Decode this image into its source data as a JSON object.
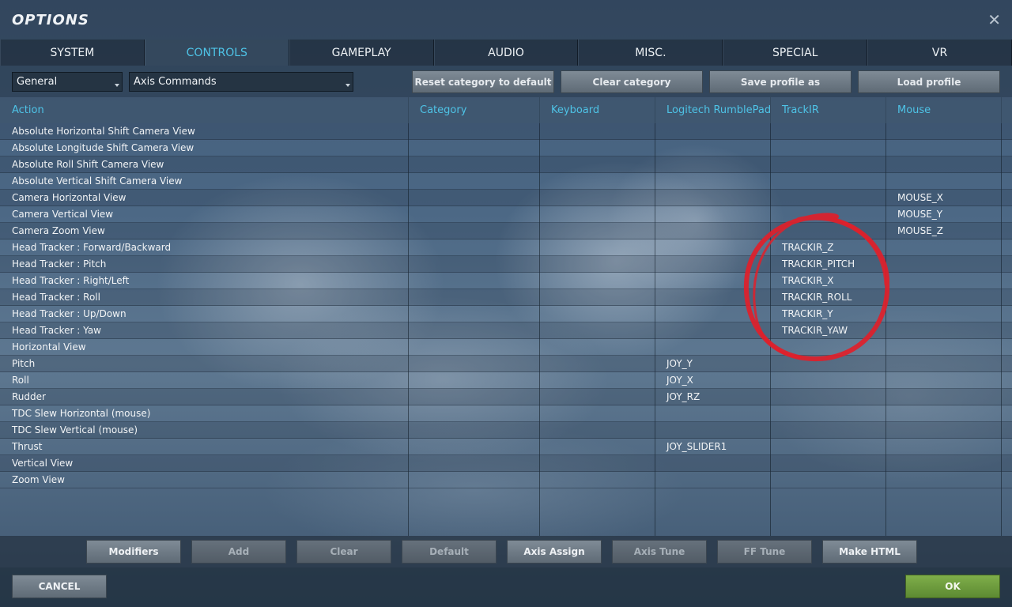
{
  "window": {
    "title": "OPTIONS",
    "close_icon": "close-icon",
    "close_glyph": "✕"
  },
  "tabs": [
    {
      "label": "SYSTEM",
      "active": false
    },
    {
      "label": "CONTROLS",
      "active": true
    },
    {
      "label": "GAMEPLAY",
      "active": false
    },
    {
      "label": "AUDIO",
      "active": false
    },
    {
      "label": "MISC.",
      "active": false
    },
    {
      "label": "SPECIAL",
      "active": false
    },
    {
      "label": "VR",
      "active": false
    }
  ],
  "toolbar": {
    "aircraft_select": "General",
    "category_select": "Axis Commands",
    "reset_label": "Reset category to default",
    "clear_category_label": "Clear category",
    "save_profile_label": "Save profile as",
    "load_profile_label": "Load profile"
  },
  "table": {
    "headers": {
      "action": "Action",
      "category": "Category",
      "keyboard": "Keyboard",
      "joystick": "Logitech RumblePad...",
      "trackir": "TrackIR",
      "mouse": "Mouse"
    },
    "rows": [
      {
        "action": "Absolute Horizontal Shift Camera View",
        "category": "",
        "keyboard": "",
        "joystick": "",
        "trackir": "",
        "mouse": ""
      },
      {
        "action": "Absolute Longitude Shift Camera View",
        "category": "",
        "keyboard": "",
        "joystick": "",
        "trackir": "",
        "mouse": ""
      },
      {
        "action": "Absolute Roll Shift Camera View",
        "category": "",
        "keyboard": "",
        "joystick": "",
        "trackir": "",
        "mouse": ""
      },
      {
        "action": "Absolute Vertical Shift Camera View",
        "category": "",
        "keyboard": "",
        "joystick": "",
        "trackir": "",
        "mouse": ""
      },
      {
        "action": "Camera Horizontal View",
        "category": "",
        "keyboard": "",
        "joystick": "",
        "trackir": "",
        "mouse": "MOUSE_X"
      },
      {
        "action": "Camera Vertical View",
        "category": "",
        "keyboard": "",
        "joystick": "",
        "trackir": "",
        "mouse": "MOUSE_Y"
      },
      {
        "action": "Camera Zoom View",
        "category": "",
        "keyboard": "",
        "joystick": "",
        "trackir": "",
        "mouse": "MOUSE_Z"
      },
      {
        "action": "Head Tracker : Forward/Backward",
        "category": "",
        "keyboard": "",
        "joystick": "",
        "trackir": "TRACKIR_Z",
        "mouse": ""
      },
      {
        "action": "Head Tracker : Pitch",
        "category": "",
        "keyboard": "",
        "joystick": "",
        "trackir": "TRACKIR_PITCH",
        "mouse": ""
      },
      {
        "action": "Head Tracker : Right/Left",
        "category": "",
        "keyboard": "",
        "joystick": "",
        "trackir": "TRACKIR_X",
        "mouse": ""
      },
      {
        "action": "Head Tracker : Roll",
        "category": "",
        "keyboard": "",
        "joystick": "",
        "trackir": "TRACKIR_ROLL",
        "mouse": ""
      },
      {
        "action": "Head Tracker : Up/Down",
        "category": "",
        "keyboard": "",
        "joystick": "",
        "trackir": "TRACKIR_Y",
        "mouse": ""
      },
      {
        "action": "Head Tracker : Yaw",
        "category": "",
        "keyboard": "",
        "joystick": "",
        "trackir": "TRACKIR_YAW",
        "mouse": ""
      },
      {
        "action": "Horizontal View",
        "category": "",
        "keyboard": "",
        "joystick": "",
        "trackir": "",
        "mouse": ""
      },
      {
        "action": "Pitch",
        "category": "",
        "keyboard": "",
        "joystick": "JOY_Y",
        "trackir": "",
        "mouse": ""
      },
      {
        "action": "Roll",
        "category": "",
        "keyboard": "",
        "joystick": "JOY_X",
        "trackir": "",
        "mouse": ""
      },
      {
        "action": "Rudder",
        "category": "",
        "keyboard": "",
        "joystick": "JOY_RZ",
        "trackir": "",
        "mouse": ""
      },
      {
        "action": "TDC Slew Horizontal (mouse)",
        "category": "",
        "keyboard": "",
        "joystick": "",
        "trackir": "",
        "mouse": ""
      },
      {
        "action": "TDC Slew Vertical (mouse)",
        "category": "",
        "keyboard": "",
        "joystick": "",
        "trackir": "",
        "mouse": ""
      },
      {
        "action": "Thrust",
        "category": "",
        "keyboard": "",
        "joystick": "JOY_SLIDER1",
        "trackir": "",
        "mouse": ""
      },
      {
        "action": "Vertical View",
        "category": "",
        "keyboard": "",
        "joystick": "",
        "trackir": "",
        "mouse": ""
      },
      {
        "action": "Zoom View",
        "category": "",
        "keyboard": "",
        "joystick": "",
        "trackir": "",
        "mouse": ""
      }
    ]
  },
  "actions": {
    "modifiers": "Modifiers",
    "add": "Add",
    "clear": "Clear",
    "default": "Default",
    "axis_assign": "Axis Assign",
    "axis_tune": "Axis Tune",
    "ff_tune": "FF Tune",
    "make_html": "Make HTML"
  },
  "footer": {
    "cancel_label": "CANCEL",
    "ok_label": "OK"
  },
  "colors": {
    "accent": "#4ec3e6",
    "ok_green": "#6f9e3e",
    "annotation_red": "#e0202a"
  }
}
